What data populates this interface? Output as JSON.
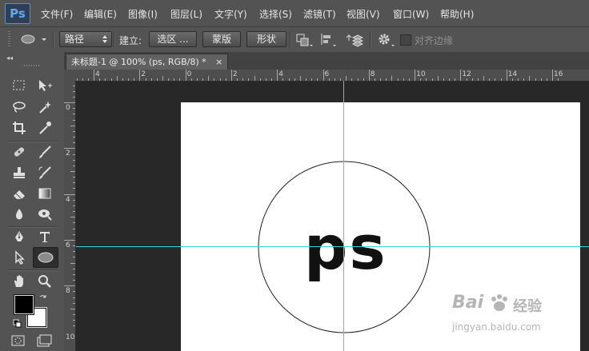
{
  "app": {
    "logo": "Ps"
  },
  "menu": [
    "文件(F)",
    "编辑(E)",
    "图像(I)",
    "图层(L)",
    "文字(Y)",
    "选择(S)",
    "滤镜(T)",
    "视图(V)",
    "窗口(W)",
    "帮助(H)"
  ],
  "options": {
    "path_mode": "路径",
    "make_label": "建立:",
    "selection_button": "选区 ...",
    "mask_button": "蒙版",
    "shape_button": "形状",
    "align_edges_label": "对齐边缘"
  },
  "document": {
    "tab_title": "未标题-1 @ 100% (ps, RGB/8) *",
    "close_symbol": "×",
    "canvas_text": "ps"
  },
  "rulers": {
    "horizontal": [
      "4",
      "2",
      "0",
      "2",
      "4",
      "6",
      "8",
      "10",
      "12",
      "14",
      "16"
    ],
    "vertical": [
      "0",
      "2",
      "4",
      "6",
      "8",
      "10"
    ]
  },
  "watermark": {
    "brand": "Bai",
    "brand_suffix": "经验",
    "url": "jingyan.baidu.com"
  },
  "colors": {
    "foreground": "#000000",
    "background": "#ffffff",
    "guide": "#35d3e6"
  },
  "icons": [
    "ellipse-tool-icon",
    "marquee-icon",
    "move-icon",
    "lasso-icon",
    "magic-wand-icon",
    "crop-icon",
    "eyedropper-icon",
    "healing-brush-icon",
    "brush-icon",
    "stamp-icon",
    "history-brush-icon",
    "eraser-icon",
    "gradient-icon",
    "blur-icon",
    "dodge-icon",
    "pen-icon",
    "type-icon",
    "path-selection-icon",
    "ellipse-shape-icon",
    "hand-icon",
    "zoom-icon",
    "gear-icon",
    "quick-mask-icon",
    "screen-mode-icon"
  ]
}
